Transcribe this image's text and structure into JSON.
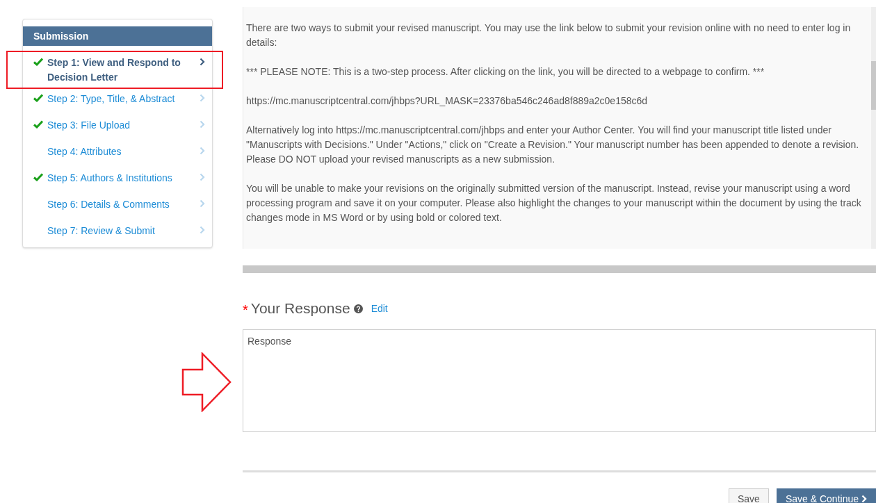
{
  "sidebar": {
    "title": "Submission",
    "steps": [
      {
        "label": "Step 1: View and Respond to Decision Letter",
        "checked": true,
        "selected": true
      },
      {
        "label": "Step 2: Type, Title, & Abstract",
        "checked": true,
        "selected": false
      },
      {
        "label": "Step 3: File Upload",
        "checked": true,
        "selected": false
      },
      {
        "label": "Step 4: Attributes",
        "checked": false,
        "selected": false
      },
      {
        "label": "Step 5: Authors & Institutions",
        "checked": true,
        "selected": false
      },
      {
        "label": "Step 6: Details & Comments",
        "checked": false,
        "selected": false
      },
      {
        "label": "Step 7: Review & Submit",
        "checked": false,
        "selected": false
      }
    ]
  },
  "decision_letter": {
    "paragraphs": [
      "There are two ways to submit your revised manuscript. You may use the link below to submit your revision online with no need to enter log in details:",
      "*** PLEASE NOTE: This is a two-step process. After clicking on the link, you will be directed to a webpage to confirm. ***",
      "https://mc.manuscriptcentral.com/jhbps?URL_MASK=23376ba546c246ad8f889a2c0e158c6d",
      "Alternatively log into https://mc.manuscriptcentral.com/jhbps and enter your Author Center. You will find your manuscript title listed under \"Manuscripts with Decisions.\"  Under \"Actions,\" click on \"Create a Revision.\"  Your manuscript number has been appended to denote a revision.  Please DO NOT upload your revised manuscripts as a new submission.",
      "You will be unable to make your revisions on the originally submitted version of the manuscript.  Instead, revise your manuscript using a word processing program and save it on your computer.  Please also highlight the changes to your manuscript within the document by using the track changes mode in MS Word or by using bold or colored text."
    ]
  },
  "response": {
    "required_mark": "*",
    "heading": "Your Response",
    "edit_link": "Edit",
    "value": "Response"
  },
  "buttons": [
    {
      "label": "Save",
      "kind": "secondary"
    },
    {
      "label": "Save & Continue",
      "kind": "primary"
    }
  ]
}
